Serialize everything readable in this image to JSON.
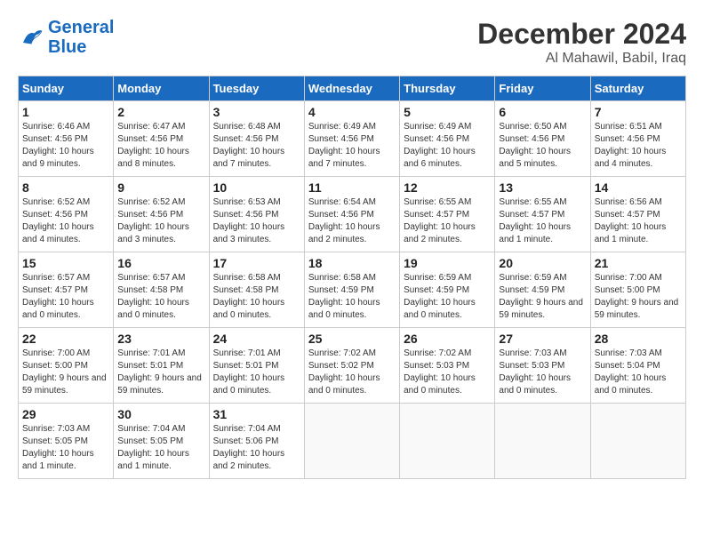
{
  "header": {
    "logo_general": "General",
    "logo_blue": "Blue",
    "month_title": "December 2024",
    "location": "Al Mahawil, Babil, Iraq"
  },
  "weekdays": [
    "Sunday",
    "Monday",
    "Tuesday",
    "Wednesday",
    "Thursday",
    "Friday",
    "Saturday"
  ],
  "weeks": [
    [
      {
        "day": "1",
        "sunrise": "6:46 AM",
        "sunset": "4:56 PM",
        "daylight": "10 hours and 9 minutes."
      },
      {
        "day": "2",
        "sunrise": "6:47 AM",
        "sunset": "4:56 PM",
        "daylight": "10 hours and 8 minutes."
      },
      {
        "day": "3",
        "sunrise": "6:48 AM",
        "sunset": "4:56 PM",
        "daylight": "10 hours and 7 minutes."
      },
      {
        "day": "4",
        "sunrise": "6:49 AM",
        "sunset": "4:56 PM",
        "daylight": "10 hours and 7 minutes."
      },
      {
        "day": "5",
        "sunrise": "6:49 AM",
        "sunset": "4:56 PM",
        "daylight": "10 hours and 6 minutes."
      },
      {
        "day": "6",
        "sunrise": "6:50 AM",
        "sunset": "4:56 PM",
        "daylight": "10 hours and 5 minutes."
      },
      {
        "day": "7",
        "sunrise": "6:51 AM",
        "sunset": "4:56 PM",
        "daylight": "10 hours and 4 minutes."
      }
    ],
    [
      {
        "day": "8",
        "sunrise": "6:52 AM",
        "sunset": "4:56 PM",
        "daylight": "10 hours and 4 minutes."
      },
      {
        "day": "9",
        "sunrise": "6:52 AM",
        "sunset": "4:56 PM",
        "daylight": "10 hours and 3 minutes."
      },
      {
        "day": "10",
        "sunrise": "6:53 AM",
        "sunset": "4:56 PM",
        "daylight": "10 hours and 3 minutes."
      },
      {
        "day": "11",
        "sunrise": "6:54 AM",
        "sunset": "4:56 PM",
        "daylight": "10 hours and 2 minutes."
      },
      {
        "day": "12",
        "sunrise": "6:55 AM",
        "sunset": "4:57 PM",
        "daylight": "10 hours and 2 minutes."
      },
      {
        "day": "13",
        "sunrise": "6:55 AM",
        "sunset": "4:57 PM",
        "daylight": "10 hours and 1 minute."
      },
      {
        "day": "14",
        "sunrise": "6:56 AM",
        "sunset": "4:57 PM",
        "daylight": "10 hours and 1 minute."
      }
    ],
    [
      {
        "day": "15",
        "sunrise": "6:57 AM",
        "sunset": "4:57 PM",
        "daylight": "10 hours and 0 minutes."
      },
      {
        "day": "16",
        "sunrise": "6:57 AM",
        "sunset": "4:58 PM",
        "daylight": "10 hours and 0 minutes."
      },
      {
        "day": "17",
        "sunrise": "6:58 AM",
        "sunset": "4:58 PM",
        "daylight": "10 hours and 0 minutes."
      },
      {
        "day": "18",
        "sunrise": "6:58 AM",
        "sunset": "4:59 PM",
        "daylight": "10 hours and 0 minutes."
      },
      {
        "day": "19",
        "sunrise": "6:59 AM",
        "sunset": "4:59 PM",
        "daylight": "10 hours and 0 minutes."
      },
      {
        "day": "20",
        "sunrise": "6:59 AM",
        "sunset": "4:59 PM",
        "daylight": "9 hours and 59 minutes."
      },
      {
        "day": "21",
        "sunrise": "7:00 AM",
        "sunset": "5:00 PM",
        "daylight": "9 hours and 59 minutes."
      }
    ],
    [
      {
        "day": "22",
        "sunrise": "7:00 AM",
        "sunset": "5:00 PM",
        "daylight": "9 hours and 59 minutes."
      },
      {
        "day": "23",
        "sunrise": "7:01 AM",
        "sunset": "5:01 PM",
        "daylight": "9 hours and 59 minutes."
      },
      {
        "day": "24",
        "sunrise": "7:01 AM",
        "sunset": "5:01 PM",
        "daylight": "10 hours and 0 minutes."
      },
      {
        "day": "25",
        "sunrise": "7:02 AM",
        "sunset": "5:02 PM",
        "daylight": "10 hours and 0 minutes."
      },
      {
        "day": "26",
        "sunrise": "7:02 AM",
        "sunset": "5:03 PM",
        "daylight": "10 hours and 0 minutes."
      },
      {
        "day": "27",
        "sunrise": "7:03 AM",
        "sunset": "5:03 PM",
        "daylight": "10 hours and 0 minutes."
      },
      {
        "day": "28",
        "sunrise": "7:03 AM",
        "sunset": "5:04 PM",
        "daylight": "10 hours and 0 minutes."
      }
    ],
    [
      {
        "day": "29",
        "sunrise": "7:03 AM",
        "sunset": "5:05 PM",
        "daylight": "10 hours and 1 minute."
      },
      {
        "day": "30",
        "sunrise": "7:04 AM",
        "sunset": "5:05 PM",
        "daylight": "10 hours and 1 minute."
      },
      {
        "day": "31",
        "sunrise": "7:04 AM",
        "sunset": "5:06 PM",
        "daylight": "10 hours and 2 minutes."
      },
      null,
      null,
      null,
      null
    ]
  ]
}
